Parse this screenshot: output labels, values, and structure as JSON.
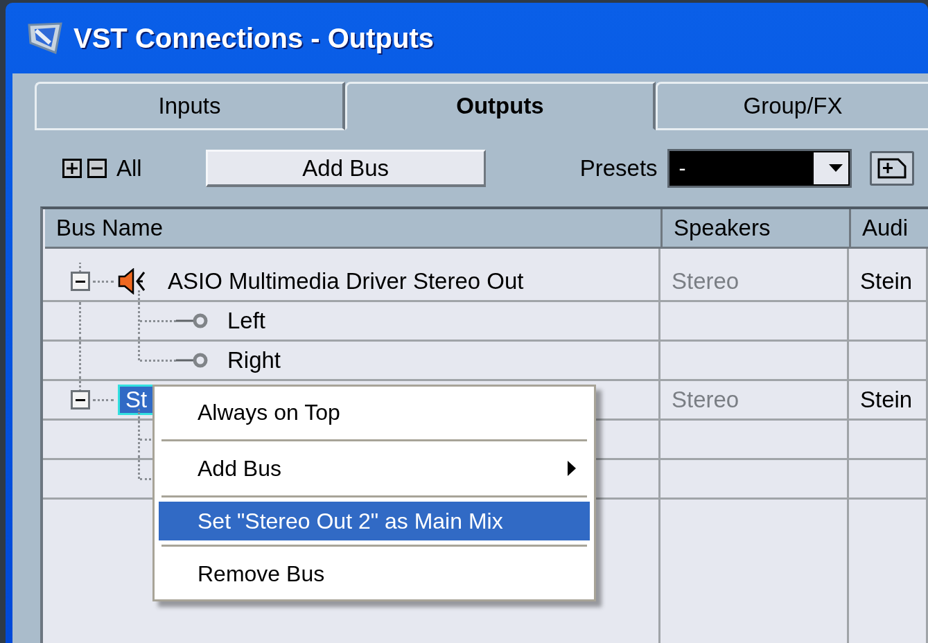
{
  "window": {
    "title": "VST Connections - Outputs"
  },
  "tabs": [
    {
      "label": "Inputs",
      "selected": false
    },
    {
      "label": "Outputs",
      "selected": true
    },
    {
      "label": "Group/FX",
      "selected": false
    }
  ],
  "toolbar": {
    "all_label": "All",
    "add_bus_button": "Add Bus",
    "presets_label": "Presets",
    "presets_value": "-"
  },
  "table": {
    "columns": [
      "Bus Name",
      "Speakers",
      "Audi"
    ],
    "rows": [
      {
        "name": "ASIO Multimedia Driver Stereo Out",
        "main_mix": true,
        "selected": false,
        "expanded": true,
        "speakers": "Stereo",
        "column_3": "Stein",
        "children": [
          {
            "kind": "channel",
            "name": "Left"
          },
          {
            "kind": "channel",
            "name": "Right"
          }
        ]
      },
      {
        "name": "St",
        "main_mix": false,
        "selected": true,
        "expanded": true,
        "speakers": "Stereo",
        "column_3": "Stein",
        "children": [
          {
            "kind": "channel"
          },
          {
            "kind": "channel"
          }
        ]
      }
    ]
  },
  "context_menu": {
    "items": [
      {
        "kind": "item",
        "label": "Always on Top",
        "submenu": false,
        "selected": false
      },
      {
        "kind": "separator"
      },
      {
        "kind": "item",
        "label": "Add Bus",
        "submenu": true,
        "selected": false
      },
      {
        "kind": "separator"
      },
      {
        "kind": "item",
        "label": "Set \"Stereo Out 2\" as Main Mix",
        "submenu": false,
        "selected": true
      },
      {
        "kind": "separator"
      },
      {
        "kind": "item",
        "label": "Remove Bus",
        "submenu": false,
        "selected": false
      }
    ]
  }
}
